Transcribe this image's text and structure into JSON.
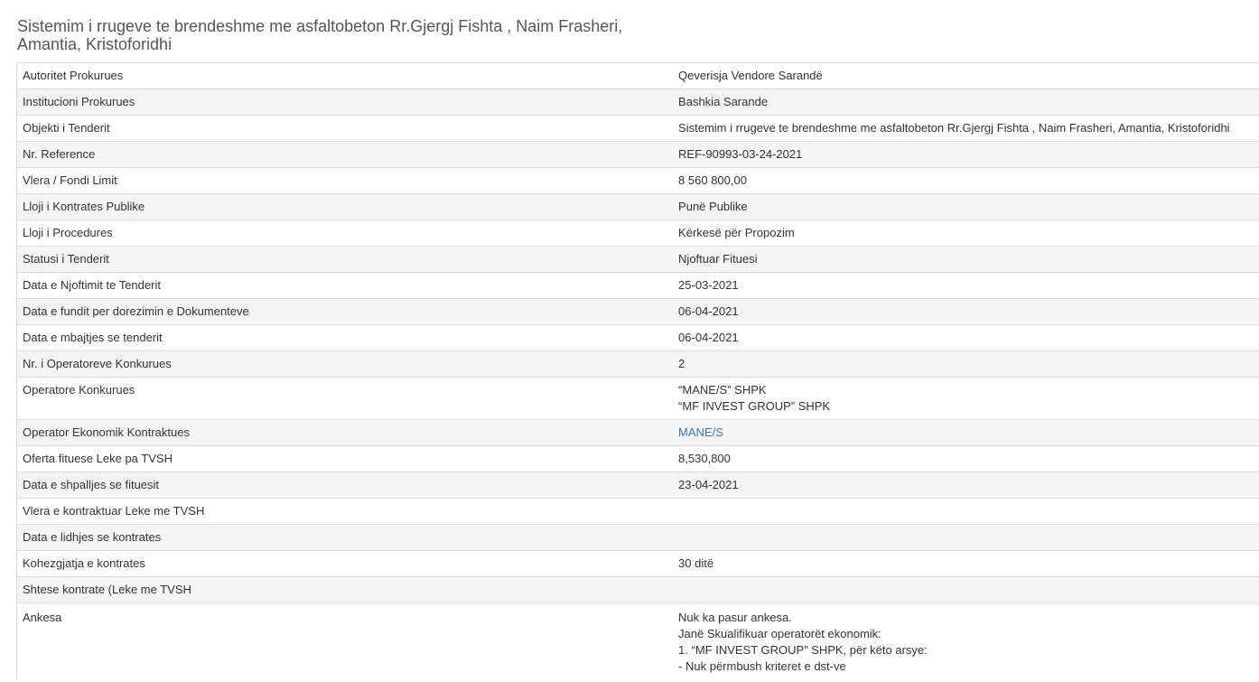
{
  "title": "Sistemim i rrugeve te brendeshme me asfaltobeton Rr.Gjergj Fishta , Naim Frasheri, Amantia, Kristoforidhi",
  "rows": [
    {
      "label": "Autoritet Prokurues",
      "value": "Qeverisja Vendore Sarandë"
    },
    {
      "label": "Institucioni Prokurues",
      "value": "Bashkia Sarande"
    },
    {
      "label": "Objekti i Tenderit",
      "value": "Sistemim i rrugeve te brendeshme me asfaltobeton Rr.Gjergj Fishta , Naim Frasheri, Amantia, Kristoforidhi"
    },
    {
      "label": "Nr. Reference",
      "value": "REF-90993-03-24-2021"
    },
    {
      "label": "Vlera / Fondi Limit",
      "value": "8 560 800,00"
    },
    {
      "label": "Lloji i Kontrates Publike",
      "value": "Punë Publike"
    },
    {
      "label": "Lloji i Procedures",
      "value": "Kërkesë për Propozim"
    },
    {
      "label": "Statusi i Tenderit",
      "value": "Njoftuar Fituesi"
    },
    {
      "label": "Data e Njoftimit te Tenderit",
      "value": "25-03-2021"
    },
    {
      "label": "Data e fundit per dorezimin e Dokumenteve",
      "value": "06-04-2021"
    },
    {
      "label": "Data e mbajtjes se tenderit",
      "value": "06-04-2021"
    },
    {
      "label": "Nr. i Operatoreve Konkurues",
      "value": "2"
    },
    {
      "label": "Operatore Konkurues",
      "lines": [
        "“MANE/S” SHPK",
        "“MF INVEST GROUP” SHPK"
      ]
    },
    {
      "label": "Operator Ekonomik Kontraktues",
      "link": "MANE/S"
    },
    {
      "label": "Oferta fituese Leke pa TVSH",
      "value": "8,530,800"
    },
    {
      "label": "Data e shpalljes se fituesit",
      "value": "23-04-2021"
    },
    {
      "label": "Vlera e kontraktuar Leke me TVSH",
      "value": ""
    },
    {
      "label": "Data e lidhjes se kontrates",
      "value": ""
    },
    {
      "label": "Kohezgjatja e kontrates",
      "value": "30 ditë"
    },
    {
      "label": "Shtese kontrate (Leke me TVSH",
      "value": ""
    },
    {
      "label": "Ankesa",
      "lines": [
        "Nuk ka pasur ankesa.",
        "Janë Skualifikuar operatorët ekonomik:",
        "1. “MF INVEST GROUP” SHPK, për këto arsye:",
        "- Nuk përmbush kriteret e dst-ve"
      ]
    }
  ],
  "colors": {
    "link": "#337ab7",
    "stripe": "#f4f4f4",
    "border": "#dddddd"
  }
}
